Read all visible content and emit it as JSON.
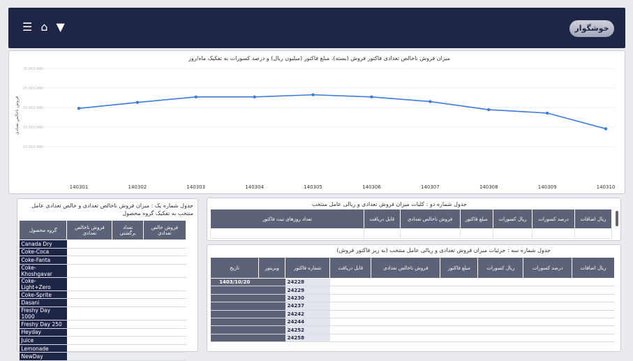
{
  "header": {
    "menu_icon": "hamburger-menu-icon",
    "home_icon": "home-icon",
    "filter_icon": "filter-icon",
    "logo_text": "خوشگوار"
  },
  "chart_section": {
    "title": "میزان فروش ناخالص تعدادی فاکتور فروش (بسته)، مبلغ فاکتور (میلیون ریال) و درصد کسورات به تفکیک ماه/روز",
    "ylabel": "فروش ناخالص تعدادی"
  },
  "chart_data": {
    "type": "line",
    "categories": [
      "140301",
      "140302",
      "140303",
      "140304",
      "140305",
      "140306",
      "140307",
      "140308",
      "140309",
      "140310"
    ],
    "series": [
      {
        "values": [
          21.6,
          23.0,
          24.3,
          24.3,
          24.8,
          24.3,
          23.2,
          21.3,
          20.5,
          16.8
        ],
        "color": "#3c7be0"
      }
    ],
    "y_ticks": [
      "30,000,000",
      "25,000,000",
      "20,000,000",
      "15,000,000",
      "10,000,000"
    ],
    "ylim": [
      8,
      31
    ],
    "grid": true
  },
  "table1": {
    "title": "جدول شماره یک : میزان فروش ناخالص تعدادی و خالص تعدادی عامل منتخب به تفکیک گروه محصول",
    "headers": [
      "گروه محصول",
      "فروش ناخالص تعدادی",
      "تعداد برگشتی",
      "فروش خالص تعدادی"
    ],
    "rows": [
      {
        "name": "Canada Dry"
      },
      {
        "name": "Coke-Coca"
      },
      {
        "name": "Coke-Fanta"
      },
      {
        "name": "Coke-Khoshgavar"
      },
      {
        "name": "Coke-Light+Zero"
      },
      {
        "name": "Coke-Sprite"
      },
      {
        "name": "Dasani"
      },
      {
        "name": "Freshy Day 1000"
      },
      {
        "name": "Freshy Day 250"
      },
      {
        "name": "Heyday"
      },
      {
        "name": "Juice"
      },
      {
        "name": "Lemonade"
      },
      {
        "name": "NewDay"
      }
    ]
  },
  "table2": {
    "title": "جدول شماره دو : کلیات میزان فروش تعدادی و ریالی عامل منتخب",
    "headers": [
      "تعداد روزهای ثبت فاکتور",
      "قابل دریافت",
      "فروش ناخالص تعدادی",
      "مبلغ فاکتور",
      "ریال کسورات",
      "درصد کسورات",
      "ریال اضافات"
    ]
  },
  "table3": {
    "title": "جدول شماره سه : جزئیات میزان فروش تعدادی و ریالی عامل منتخب (به ریز فاکتور فروش)",
    "headers": [
      "تاریخ",
      "ویزیتور",
      "شماره فاکتور",
      "قابل دریافت",
      "فروش ناخالص تعدادی",
      "مبلغ فاکتور",
      "ریال کسورات",
      "درصد کسورات",
      "ریال اضافات"
    ],
    "date_value": "1403/10/20",
    "invoice_numbers": [
      "24228",
      "24229",
      "24230",
      "24237",
      "24242",
      "24244",
      "24252",
      "24258"
    ]
  },
  "colors": {
    "navy": "#1f2547",
    "header_grey": "#5c6378",
    "line_blue": "#3c7be0"
  }
}
